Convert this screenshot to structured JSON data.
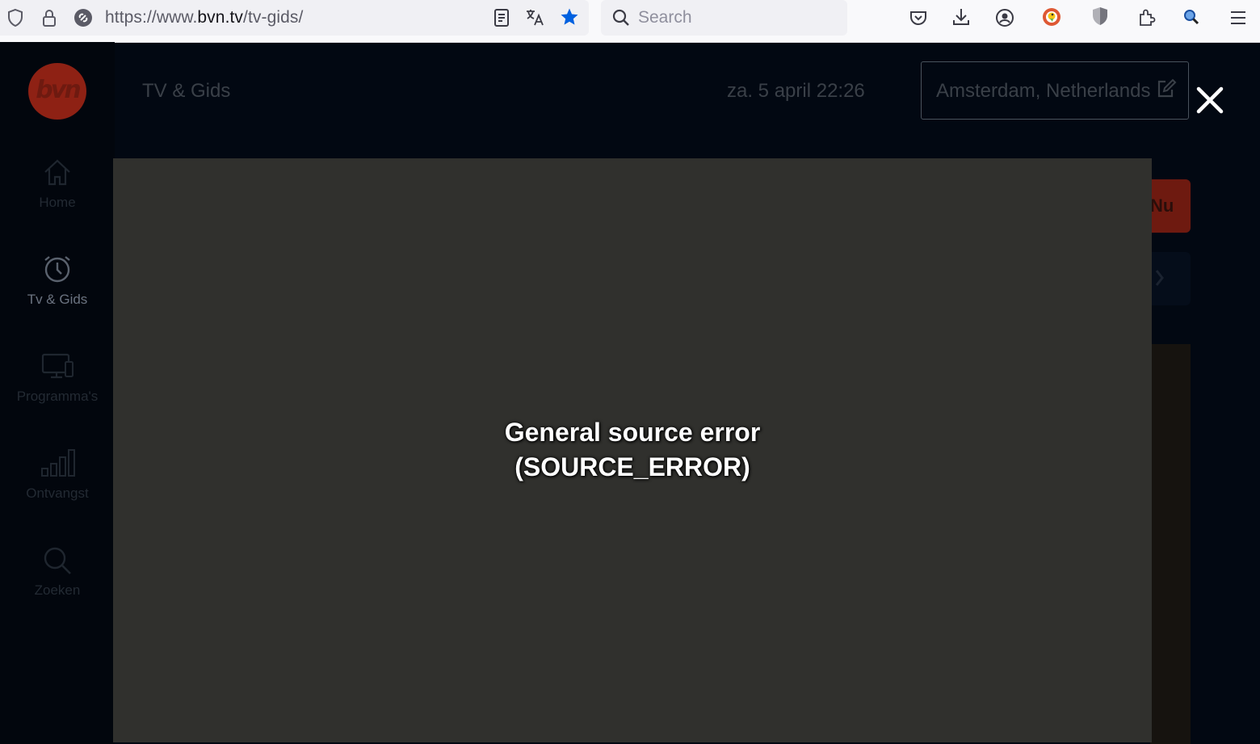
{
  "browser": {
    "url_prefix": "https://www.",
    "url_host": "bvn.tv",
    "url_path": "/tv-gids/",
    "search_placeholder": "Search",
    "icons": [
      "shield-icon",
      "lock-icon",
      "connection-icon",
      "reader-view-icon",
      "translate-icon",
      "bookmark-star-icon",
      "search-icon",
      "pocket-icon",
      "download-icon",
      "account-icon",
      "duckduckgo-icon",
      "privacy-badger-icon",
      "extensions-icon",
      "magnifier-extension-icon",
      "menu-icon"
    ]
  },
  "header": {
    "logo_text": "bvn",
    "title": "TV & Gids",
    "datetime": "za. 5 april 22:26",
    "location": "Amsterdam, Netherlands"
  },
  "sidebar": {
    "items": [
      {
        "label": "Home",
        "icon": "home-icon"
      },
      {
        "label": "Tv & Gids",
        "icon": "clock-icon"
      },
      {
        "label": "Programma's",
        "icon": "devices-icon"
      },
      {
        "label": "Ontvangst",
        "icon": "signal-bars-icon"
      },
      {
        "label": "Zoeken",
        "icon": "search-icon"
      }
    ]
  },
  "guide": {
    "now_label": "Nu"
  },
  "player": {
    "error_line1": "General source error",
    "error_line2": "(SOURCE_ERROR)"
  },
  "colors": {
    "accent": "#0061e0",
    "brand": "#8e2114",
    "modal_bg": "#30302d",
    "page_bg": "#020812"
  }
}
